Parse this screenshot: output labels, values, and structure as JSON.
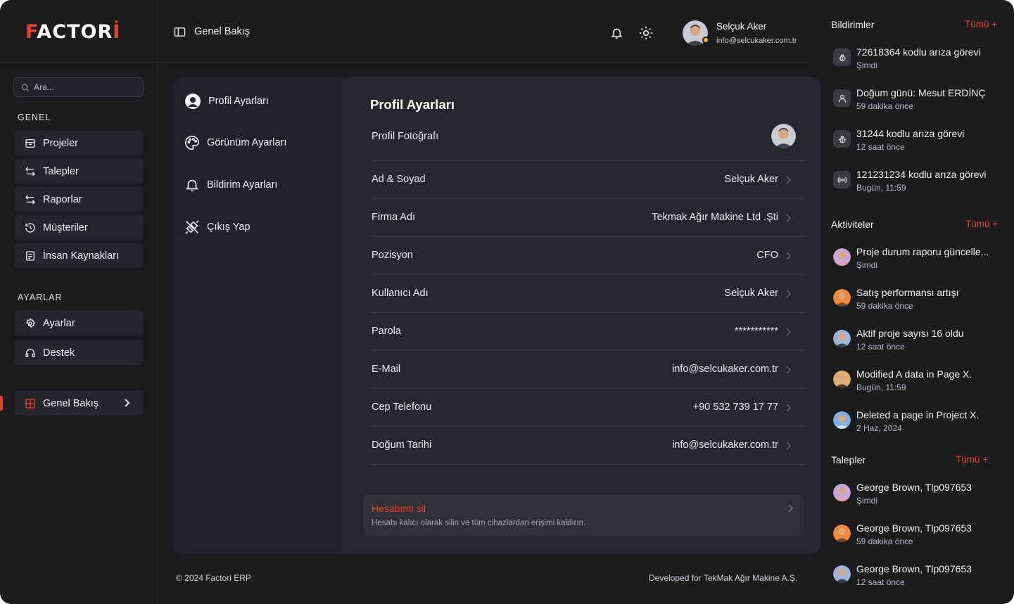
{
  "brand": {
    "logo_text": "FACTORİ"
  },
  "sidebar": {
    "search_placeholder": "Ara...",
    "section_general": "GENEL",
    "section_settings": "AYARLAR",
    "items": [
      {
        "label": "Projeler",
        "icon": "projects-icon"
      },
      {
        "label": "Talepler",
        "icon": "arrows-icon"
      },
      {
        "label": "Raporlar",
        "icon": "arrows-icon"
      },
      {
        "label": "Müşteriler",
        "icon": "history-icon"
      },
      {
        "label": "İnsan Kaynakları",
        "icon": "document-icon"
      }
    ],
    "settings_items": [
      {
        "label": "Ayarlar",
        "icon": "gear-icon"
      },
      {
        "label": "Destek",
        "icon": "headset-icon"
      }
    ],
    "overview": {
      "label": "Genel Bakış",
      "icon": "grid-icon",
      "accent": "#e8412f"
    }
  },
  "header": {
    "breadcrumb": "Genel Bakış",
    "user_name": "Selçuk Aker",
    "user_email": "info@selcukaker.com.tr"
  },
  "settings_menu": [
    {
      "label": "Profil Ayarları",
      "icon": "user-icon"
    },
    {
      "label": "Görünüm Ayarları",
      "icon": "palette-icon"
    },
    {
      "label": "Bildirim Ayarları",
      "icon": "bell-icon"
    },
    {
      "label": "Çıkış Yap",
      "icon": "unplug-icon"
    }
  ],
  "profile": {
    "title": "Profil Ayarları",
    "photo_label": "Profil Fotoğrafı",
    "rows": [
      {
        "label": "Ad & Soyad",
        "value": "Selçuk Aker"
      },
      {
        "label": "Firma Adı",
        "value": "Tekmak Ağır Makine Ltd .Şti"
      },
      {
        "label": "Pozisyon",
        "value": "CFO"
      },
      {
        "label": "Kullanıcı Adı",
        "value": "Selçuk Aker"
      },
      {
        "label": "Parola",
        "value": "***********"
      },
      {
        "label": "E-Mail",
        "value": "info@selcukaker.com.tr"
      },
      {
        "label": "Cep Telefonu",
        "value": "+90 532 739 17 77"
      },
      {
        "label": "Doğum Tarihi",
        "value": "info@selcukaker.com.tr"
      }
    ],
    "delete_title": "Hesabımı sil",
    "delete_desc": "Hesabı kalıcı olarak silin ve tüm cihazlardan erişimi kaldırın."
  },
  "footer": {
    "left": "© 2024 Factori ERP",
    "right": "Developed for TekMak Ağır Makine A.Ş."
  },
  "notifications": {
    "title": "Bildirimler",
    "all": "Tümü +",
    "items": [
      {
        "text": "72618364 kodlu arıza görevi",
        "time": "Şimdi",
        "icon": "bug-icon"
      },
      {
        "text": "Doğum günü: Mesut ERDİNÇ",
        "time": "59 dakika önce",
        "icon": "user-icon"
      },
      {
        "text": "31244 kodlu arıza görevi",
        "time": "12 saat önce",
        "icon": "bug-icon"
      },
      {
        "text": "121231234 kodlu arıza görevi",
        "time": "Bugün, 11:59",
        "icon": "broadcast-icon"
      }
    ]
  },
  "activities": {
    "title": "Aktiviteler",
    "all": "Tümü +",
    "items": [
      {
        "text": "Proje durum raporu güncelle...",
        "time": "Şimdi"
      },
      {
        "text": "Satış performansı artışı",
        "time": "59 dakika önce"
      },
      {
        "text": "Aktif proje sayısı 16 oldu",
        "time": "12 saat önce"
      },
      {
        "text": "Modified A data in Page X.",
        "time": "Bugün, 11:59"
      },
      {
        "text": "Deleted a page in Project X.",
        "time": "2 Haz, 2024"
      }
    ]
  },
  "requests": {
    "title": "Talepler",
    "all": "Tümü +",
    "items": [
      {
        "text": "George Brown, Tlp097653",
        "time": "Şimdi"
      },
      {
        "text": "George Brown, Tlp097653",
        "time": "59 dakika önce"
      },
      {
        "text": "George Brown, Tlp097653",
        "time": "12 saat önce"
      }
    ]
  }
}
